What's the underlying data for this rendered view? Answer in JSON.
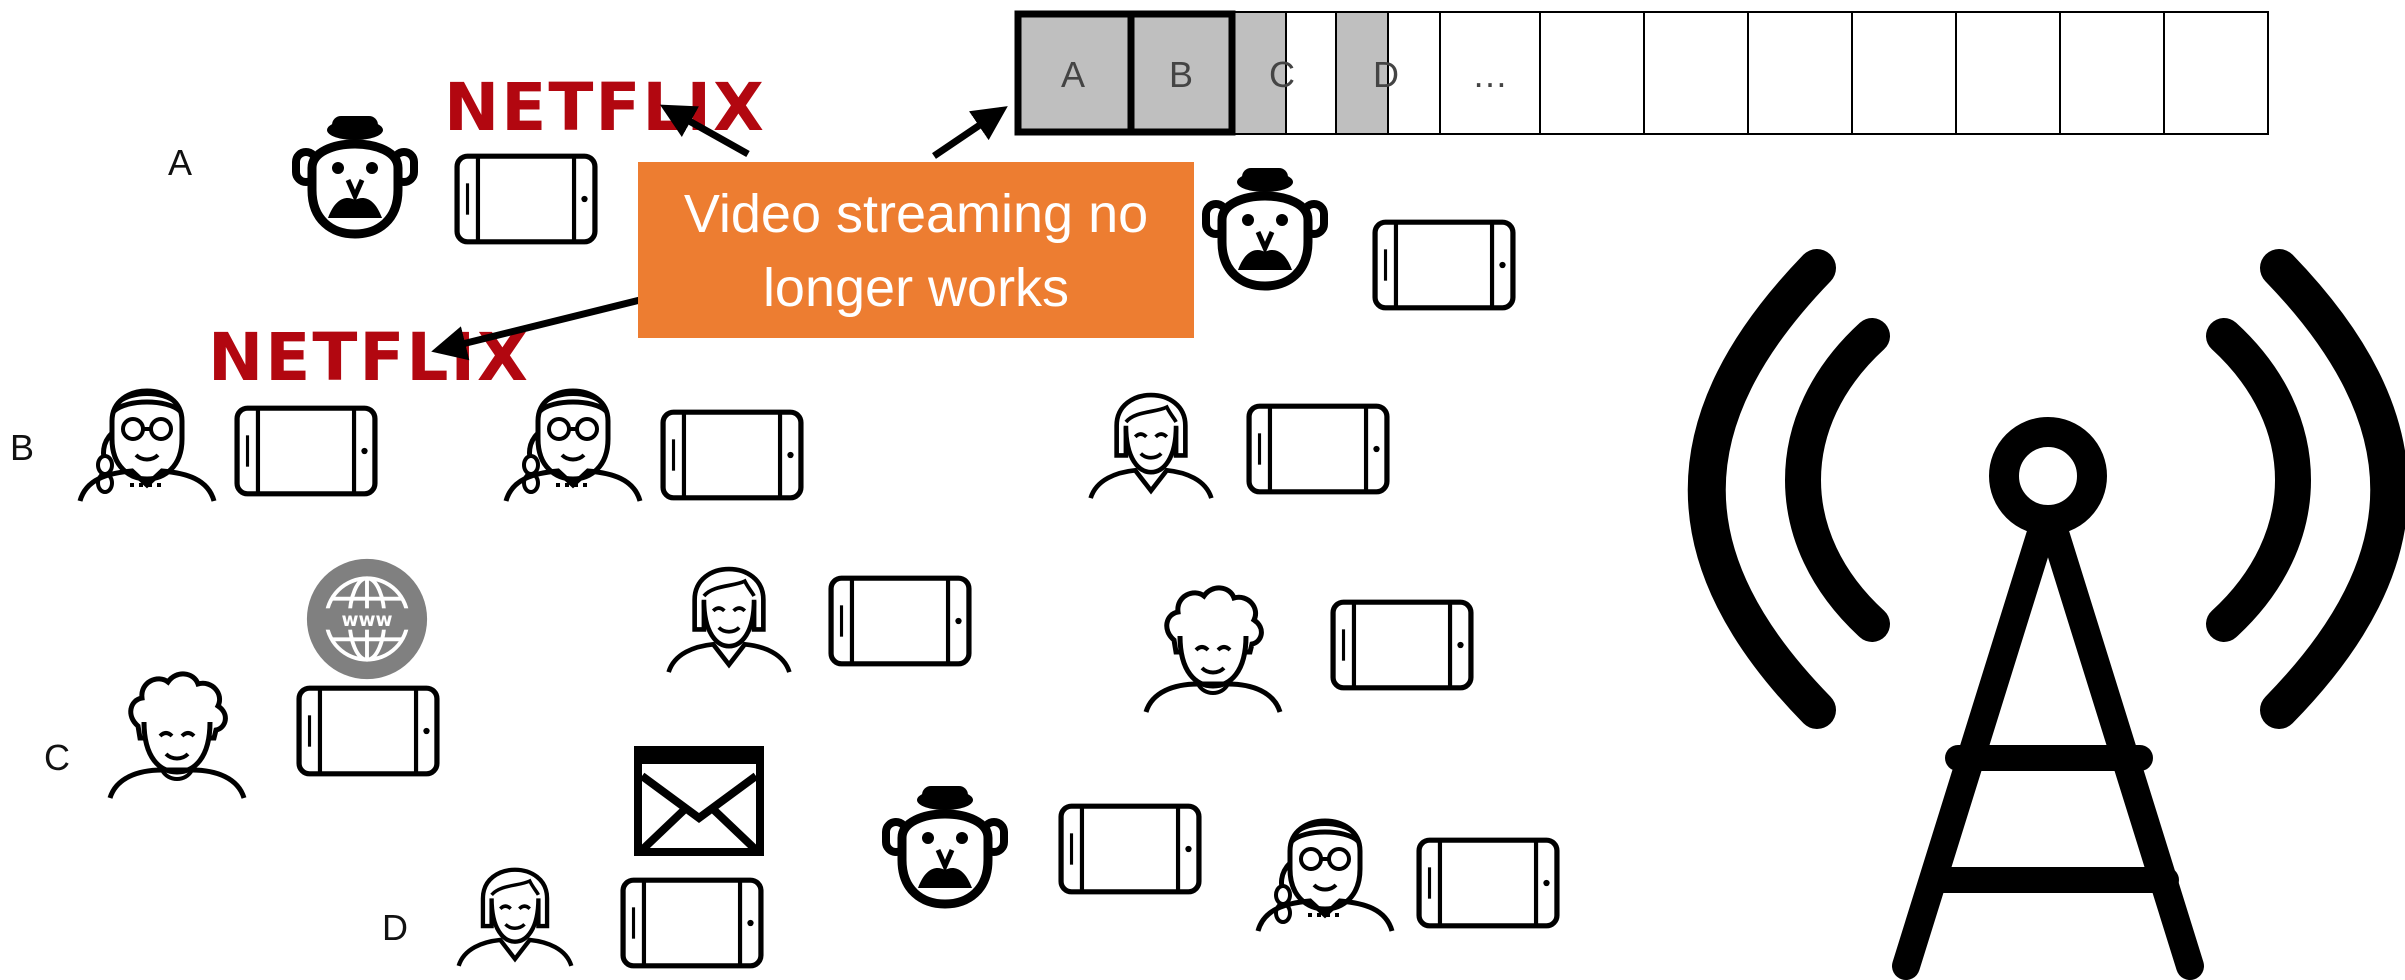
{
  "user_labels": [
    "A",
    "B",
    "C",
    "D"
  ],
  "queue": {
    "cells": [
      "A",
      "B",
      "C",
      "D",
      "…",
      "",
      "",
      "",
      "",
      "",
      "",
      "",
      ""
    ],
    "highlighted": [
      "A",
      "B"
    ],
    "shaded": [
      "C",
      "D"
    ]
  },
  "callout": {
    "line1": "Video streaming no",
    "line2": "longer works"
  },
  "logos": {
    "netflix": "NETFLIX"
  },
  "colors": {
    "callout_bg": "#ed7d31",
    "netflix_red": "#b20710",
    "queue_shade": "#bfbfbf",
    "www_gray": "#808080"
  },
  "icons": [
    "person-bowler-mustache-icon",
    "person-woman-glasses-braid-icon",
    "person-woman-bangs-icon",
    "person-curly-hair-icon",
    "smartphone-icon",
    "envelope-icon",
    "globe-www-icon",
    "cell-tower-icon"
  ]
}
